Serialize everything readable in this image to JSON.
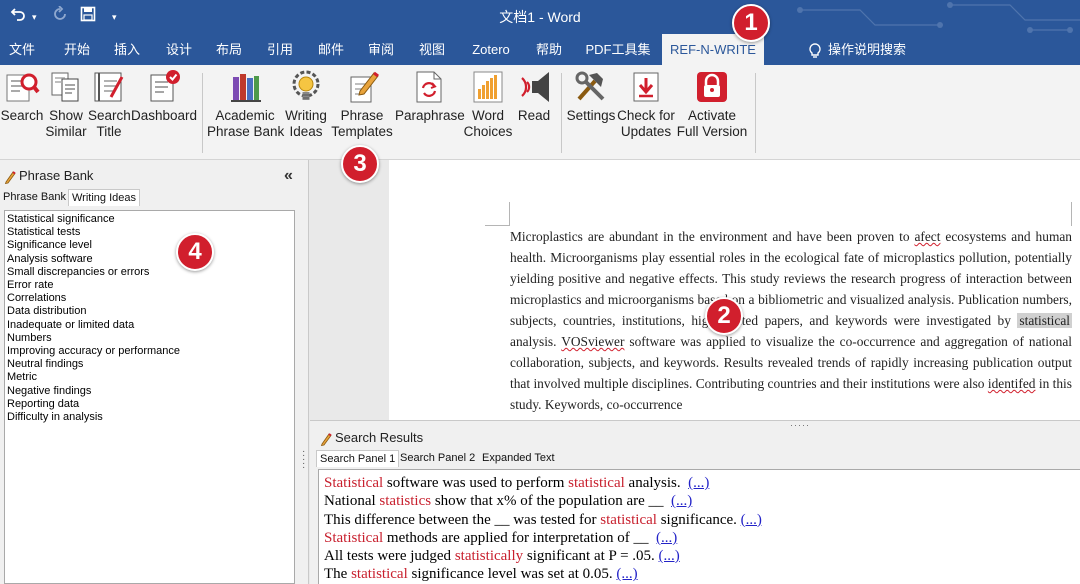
{
  "window": {
    "title": "文档1 - Word"
  },
  "ribbon_tabs": [
    {
      "label": "文件"
    },
    {
      "label": "开始"
    },
    {
      "label": "插入"
    },
    {
      "label": "设计"
    },
    {
      "label": "布局"
    },
    {
      "label": "引用"
    },
    {
      "label": "邮件"
    },
    {
      "label": "审阅"
    },
    {
      "label": "视图"
    },
    {
      "label": "Zotero"
    },
    {
      "label": "帮助"
    },
    {
      "label": "PDF工具集"
    },
    {
      "label": "REF-N-WRITE"
    }
  ],
  "tell_me": "操作说明搜索",
  "ribbon_buttons": [
    {
      "l1": "Search",
      "l2": "",
      "icon": "search-icon"
    },
    {
      "l1": "Show",
      "l2": "Similar",
      "icon": "show-similar-icon"
    },
    {
      "l1": "Search",
      "l2": "Title",
      "icon": "search-title-icon"
    },
    {
      "l1": "Dashboard",
      "l2": "",
      "icon": "dashboard-icon"
    },
    {
      "l1": "Academic",
      "l2": "Phrase Bank",
      "icon": "books-icon"
    },
    {
      "l1": "Writing",
      "l2": "Ideas",
      "icon": "lightbulb-gear-icon"
    },
    {
      "l1": "Phrase",
      "l2": "Templates",
      "icon": "pencil-doc-icon"
    },
    {
      "l1": "Paraphrase",
      "l2": "",
      "icon": "paraphrase-doc-icon"
    },
    {
      "l1": "Word",
      "l2": "Choices",
      "icon": "bar-chart-icon"
    },
    {
      "l1": "Read",
      "l2": "",
      "icon": "speaker-icon"
    },
    {
      "l1": "Settings",
      "l2": "",
      "icon": "tools-icon"
    },
    {
      "l1": "Check for",
      "l2": "Updates",
      "icon": "download-icon"
    },
    {
      "l1": "Activate",
      "l2": "Full Version",
      "icon": "lock-icon"
    }
  ],
  "badges": [
    "1",
    "2",
    "3",
    "4"
  ],
  "phrase_bank": {
    "title": "Phrase Bank",
    "collapse": "«",
    "tabs": [
      "Phrase Bank",
      "Writing Ideas"
    ],
    "items": [
      "Statistical significance",
      "Statistical tests",
      "Significance level",
      "Analysis software",
      "Small discrepancies or errors",
      "Error rate",
      "Correlations",
      "Data distribution",
      "Inadequate or limited data",
      "Numbers",
      "Improving accuracy or performance",
      "Neutral findings",
      "Metric",
      "Negative findings",
      "Reporting data",
      "Difficulty in analysis"
    ]
  },
  "document": {
    "p1": "Microplastics are abundant in the environment and have been proven to ",
    "typo1": "afect",
    "p2": " ecosystems and human health. Microorganisms play essential roles in the ecological fate of microplastics pollution, potentially yielding positive and negative effects. This study reviews the research progress of interaction between microplastics and microorganisms based on a bibliometric and visualized analysis. Publication numbers, subjects, countries, institutions, highly cited papers, and keywords were investigated by ",
    "highlight": "statistical",
    "p3": " analysis. ",
    "typo2": "VOSviewer",
    "p4": " software was applied to visualize the co-occurrence and aggregation of national collaboration, subjects, and keywords. Results revealed trends of rapidly increasing publication output that involved multiple disciplines. Contributing countries and their institutions were also ",
    "typo3": "identifed",
    "p5": " in this study. Keywords, co-occurrence"
  },
  "search_results": {
    "title": "Search Results",
    "tabs": [
      "Search Panel 1",
      "Search Panel 2",
      "Expanded Text"
    ],
    "more": "(...)",
    "rows": [
      {
        "pre": "",
        "kw": "Statistical",
        "post": " software was used to perform ",
        "kw2": "statistical",
        "post2": " analysis."
      },
      {
        "pre": "National ",
        "kw": "statistics",
        "post": " show that x% of the population are __",
        "kw2": "",
        "post2": ""
      },
      {
        "pre": "This difference between the __ was tested for ",
        "kw": "statistical",
        "post": " significance.",
        "kw2": "",
        "post2": ""
      },
      {
        "pre": "",
        "kw": "Statistical",
        "post": " methods are applied for interpretation of __",
        "kw2": "",
        "post2": ""
      },
      {
        "pre": "All tests were judged ",
        "kw": "statistically",
        "post": " significant at P = .05.",
        "kw2": "",
        "post2": ""
      },
      {
        "pre": "The ",
        "kw": "statistical",
        "post": " significance level was set at 0.05.",
        "kw2": "",
        "post2": ""
      }
    ]
  },
  "colors": {
    "word_blue": "#2b579a",
    "badge_red": "#d11f2d",
    "keyword_red": "#c8202e",
    "link_blue": "#2323c8"
  }
}
